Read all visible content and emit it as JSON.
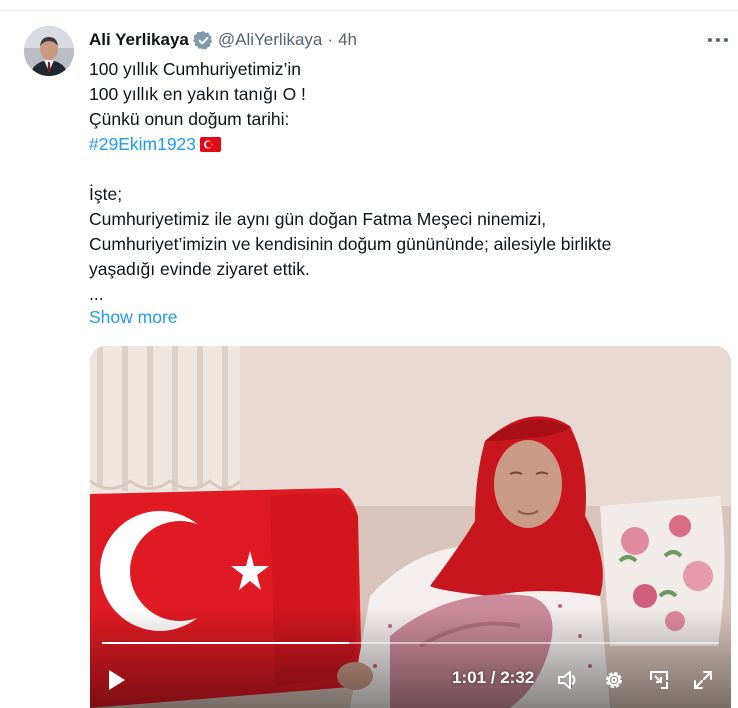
{
  "tweet": {
    "author_name": "Ali Yerlikaya",
    "handle": "@AliYerlikaya",
    "separator": "·",
    "time": "4h",
    "lines": [
      "100 yıllık Cumhuriyetimiz’in",
      "100 yıllık en yakın tanığı O !",
      "Çünkü onun doğum tarihi:"
    ],
    "hashtag": "#29Ekim1923",
    "lines2": [
      "İşte;",
      "Cumhuriyetimiz ile aynı gün doğan Fatma Meşeci ninemizi,",
      "Cumhuriyet’imizin ve kendisinin doğum günününde; ailesiyle birlikte",
      "yaşadığı evinde ziyaret ettik.",
      "..."
    ],
    "show_more": "Show more"
  },
  "video": {
    "current_time": "1:01",
    "duration": "2:32",
    "time_separator": " / ",
    "progress_fraction": 0.4
  },
  "icons": {
    "verified": "verified-badge-icon",
    "more": "more-icon",
    "play": "play-icon",
    "volume": "volume-icon",
    "settings": "gear-icon",
    "pip": "picture-in-picture-icon",
    "fullscreen": "fullscreen-icon"
  },
  "colors": {
    "link": "#1d9bf0",
    "text": "#0f1419",
    "muted": "#536471",
    "flag_red": "#e30a17"
  }
}
